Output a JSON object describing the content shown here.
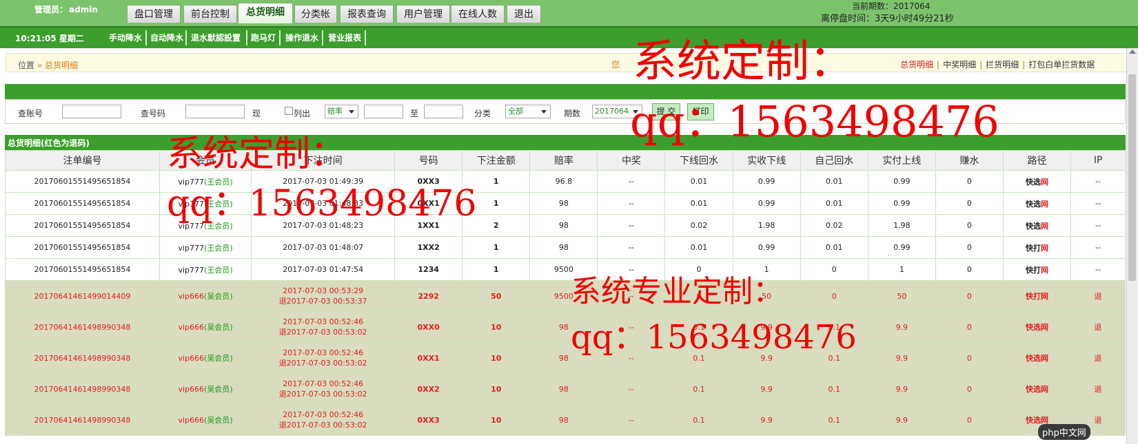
{
  "header": {
    "admin_label": "管理员：",
    "admin_name": "admin",
    "period_label": "当前期数：2017064",
    "closing_label": "离停盘时间：3天9小时49分21秒"
  },
  "main_tabs": [
    "盘口管理",
    "前台控制",
    "总货明细",
    "分类帐",
    "报表查询",
    "用户管理",
    "在线人数",
    "退出"
  ],
  "active_tab": "总货明细",
  "subbar": {
    "clock": "10:21:05 星期二",
    "items": [
      "手动降水",
      "自动降水",
      "退水默認設置",
      "跑马灯",
      "操作退水",
      "营业报表"
    ]
  },
  "breadcrumb": {
    "position": "位置",
    "sep": "»",
    "current": "总货明细",
    "marquee": "您"
  },
  "right_links": [
    "总货明细",
    "中奖明细",
    "拦货明细",
    "打包白单拦货数据"
  ],
  "filter": {
    "account_label": "查账号",
    "number_label": "查号码",
    "now_label": "现",
    "list_label": "列出",
    "list_select": "赔率",
    "to_label": "至",
    "category_label": "分类",
    "category_select": "全部",
    "period_label": "期数",
    "period_select": "2017064",
    "submit_label": "提 交",
    "print_label": "打印"
  },
  "table": {
    "title": "总货明细(红色为退码)",
    "headers": [
      "注单编号",
      "会员",
      "下注时间",
      "号码",
      "下注金额",
      "赔率",
      "中奖",
      "下线回水",
      "实收下线",
      "自己回水",
      "实付上线",
      "赚水",
      "路径",
      "IP"
    ],
    "rows": [
      {
        "id": "20170601551495651854",
        "user": "vip777",
        "member": "王会员",
        "time": "2017-07-03 01:49:39",
        "time2": "",
        "code": "0XX3",
        "amount": "1",
        "odds": "96.8",
        "win": "--",
        "down_rebate": "0.01",
        "down_recv": "0.99",
        "self_rebate": "0.01",
        "up_pay": "0.99",
        "earn": "0",
        "path": "快选",
        "net": "网",
        "ip": "--",
        "refund": false
      },
      {
        "id": "20170601551495651854",
        "user": "vip777",
        "member": "王会员",
        "time": "2017-07-03 01:48:33",
        "time2": "",
        "code": "0XX1",
        "amount": "1",
        "odds": "98",
        "win": "--",
        "down_rebate": "0.01",
        "down_recv": "0.99",
        "self_rebate": "0.01",
        "up_pay": "0.99",
        "earn": "0",
        "path": "快选",
        "net": "网",
        "ip": "--",
        "refund": false
      },
      {
        "id": "20170601551495651854",
        "user": "vip777",
        "member": "王会员",
        "time": "2017-07-03 01:48:23",
        "time2": "",
        "code": "1XX1",
        "amount": "2",
        "odds": "98",
        "win": "--",
        "down_rebate": "0.02",
        "down_recv": "1.98",
        "self_rebate": "0.02",
        "up_pay": "1.98",
        "earn": "0",
        "path": "快选",
        "net": "网",
        "ip": "--",
        "refund": false
      },
      {
        "id": "20170601551495651854",
        "user": "vip777",
        "member": "王会员",
        "time": "2017-07-03 01:48:07",
        "time2": "",
        "code": "1XX2",
        "amount": "1",
        "odds": "98",
        "win": "--",
        "down_rebate": "0.01",
        "down_recv": "0.99",
        "self_rebate": "0.01",
        "up_pay": "0.99",
        "earn": "0",
        "path": "快打",
        "net": "网",
        "ip": "--",
        "refund": false
      },
      {
        "id": "20170601551495651854",
        "user": "vip777",
        "member": "王会员",
        "time": "2017-07-03 01:47:54",
        "time2": "",
        "code": "1234",
        "amount": "1",
        "odds": "9500",
        "win": "--",
        "down_rebate": "0",
        "down_recv": "1",
        "self_rebate": "0",
        "up_pay": "1",
        "earn": "0",
        "path": "快打",
        "net": "网",
        "ip": "--",
        "refund": false
      },
      {
        "id": "20170641461499014409",
        "user": "vip666",
        "member": "吴会员",
        "time": "2017-07-03 00:53:29",
        "time2": "退2017-07-03 00:53:37",
        "code": "2292",
        "amount": "50",
        "odds": "9500",
        "win": "--",
        "down_rebate": "0",
        "down_recv": "50",
        "self_rebate": "0",
        "up_pay": "50",
        "earn": "0",
        "path": "快打",
        "net": "网",
        "ip": "退",
        "refund": true
      },
      {
        "id": "20170641461498990348",
        "user": "vip666",
        "member": "吴会员",
        "time": "2017-07-03 00:52:46",
        "time2": "退2017-07-03 00:53:02",
        "code": "0XX0",
        "amount": "10",
        "odds": "98",
        "win": "--",
        "down_rebate": "0.1",
        "down_recv": "9.9",
        "self_rebate": "0.1",
        "up_pay": "9.9",
        "earn": "0",
        "path": "快选",
        "net": "网",
        "ip": "退",
        "refund": true
      },
      {
        "id": "20170641461498990348",
        "user": "vip666",
        "member": "吴会员",
        "time": "2017-07-03 00:52:46",
        "time2": "退2017-07-03 00:53:02",
        "code": "0XX1",
        "amount": "10",
        "odds": "98",
        "win": "--",
        "down_rebate": "0.1",
        "down_recv": "9.9",
        "self_rebate": "0.1",
        "up_pay": "9.9",
        "earn": "0",
        "path": "快选",
        "net": "网",
        "ip": "退",
        "refund": true
      },
      {
        "id": "20170641461498990348",
        "user": "vip666",
        "member": "吴会员",
        "time": "2017-07-03 00:52:46",
        "time2": "退2017-07-03 00:53:02",
        "code": "0XX2",
        "amount": "10",
        "odds": "98",
        "win": "--",
        "down_rebate": "0.1",
        "down_recv": "9.9",
        "self_rebate": "0.1",
        "up_pay": "9.9",
        "earn": "0",
        "path": "快选",
        "net": "网",
        "ip": "退",
        "refund": true
      },
      {
        "id": "20170641461498990348",
        "user": "vip666",
        "member": "吴会员",
        "time": "2017-07-03 00:52:46",
        "time2": "退2017-07-03 00:53:02",
        "code": "0XX3",
        "amount": "10",
        "odds": "98",
        "win": "--",
        "down_rebate": "0.1",
        "down_recv": "9.9",
        "self_rebate": "0.1",
        "up_pay": "9.9",
        "earn": "0",
        "path": "快选",
        "net": "网",
        "ip": "退",
        "refund": true
      }
    ]
  },
  "watermark": {
    "line1": "系统定制：",
    "line2": "qq：1563498476",
    "line3": "系统专业定制：",
    "logo": "php中文网"
  },
  "colors": {
    "brand_green": "#3c9e2c",
    "light_green": "#7cc46c",
    "refund_red": "#e02020",
    "refund_row_bg": "#d9dcbe",
    "member_green": "#1a9a1a"
  }
}
